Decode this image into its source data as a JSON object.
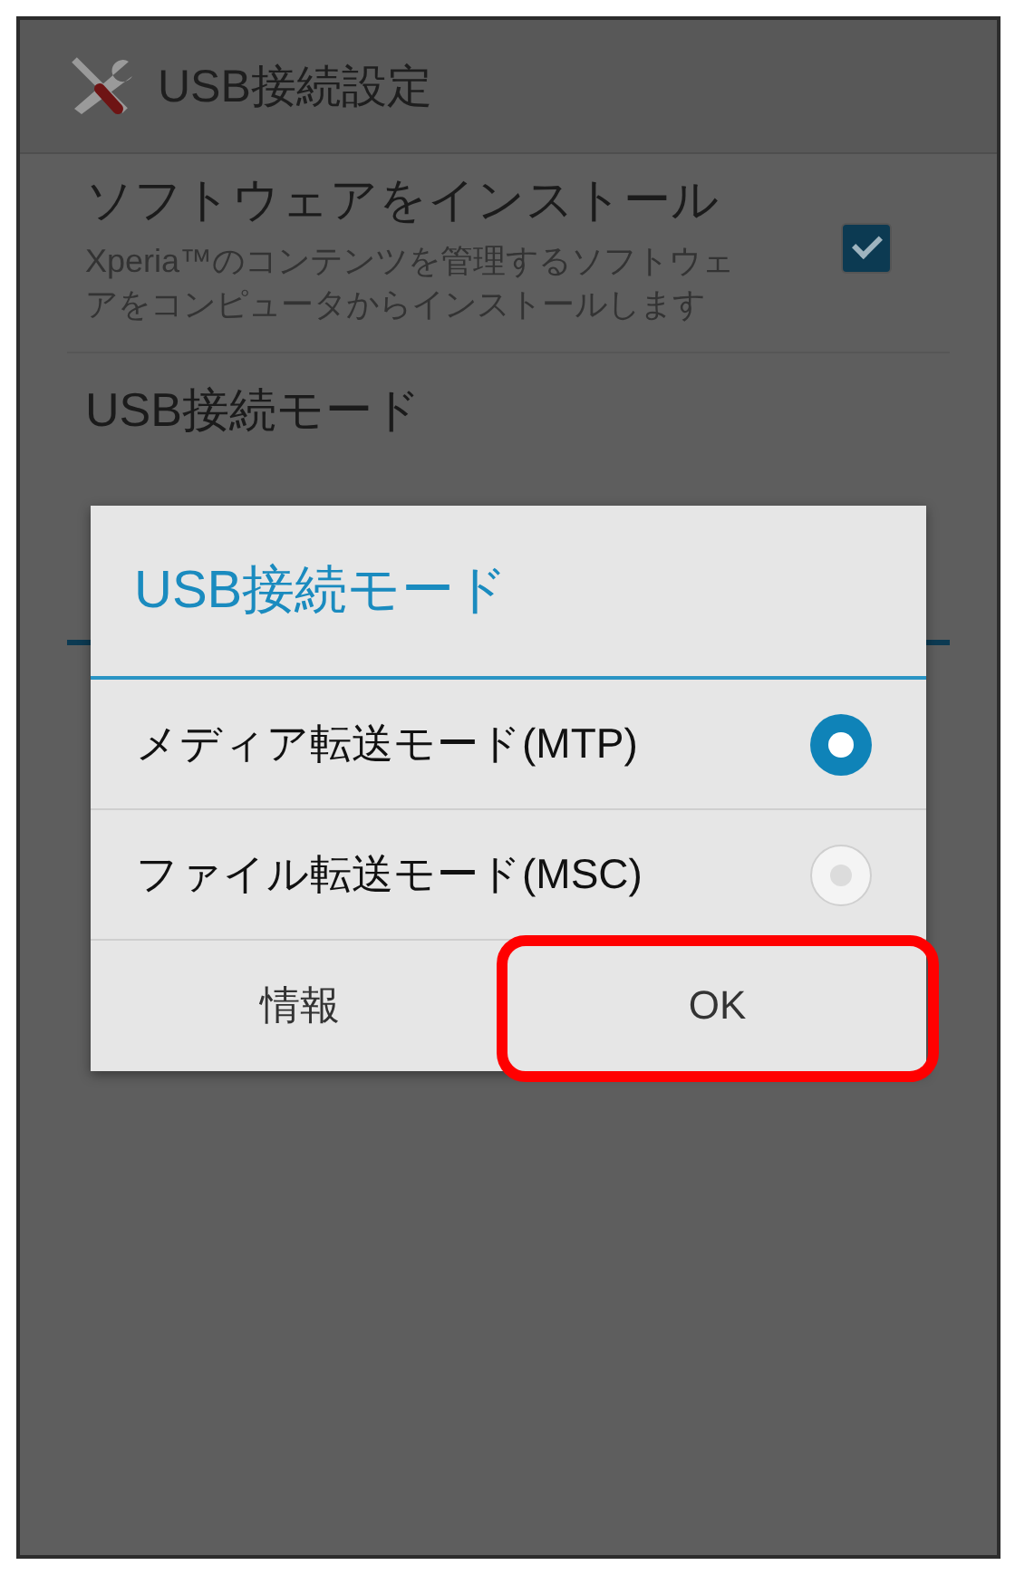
{
  "app_bar": {
    "title": "USB接続設定"
  },
  "settings": [
    {
      "kind": "checkbox",
      "title": "ソフトウェアをインストール",
      "summary": "Xperia™のコンテンツを管理するソフトウェアをコンピュータからインストールします",
      "checked": true
    },
    {
      "kind": "plain",
      "title": "USB接続モード"
    }
  ],
  "dialog": {
    "title": "USB接続モード",
    "options": [
      {
        "label": "メディア転送モード(MTP)",
        "selected": true
      },
      {
        "label": "ファイル転送モード(MSC)",
        "selected": false
      }
    ],
    "buttons": [
      {
        "label": "情報",
        "highlighted": false
      },
      {
        "label": "OK",
        "highlighted": true
      }
    ]
  }
}
